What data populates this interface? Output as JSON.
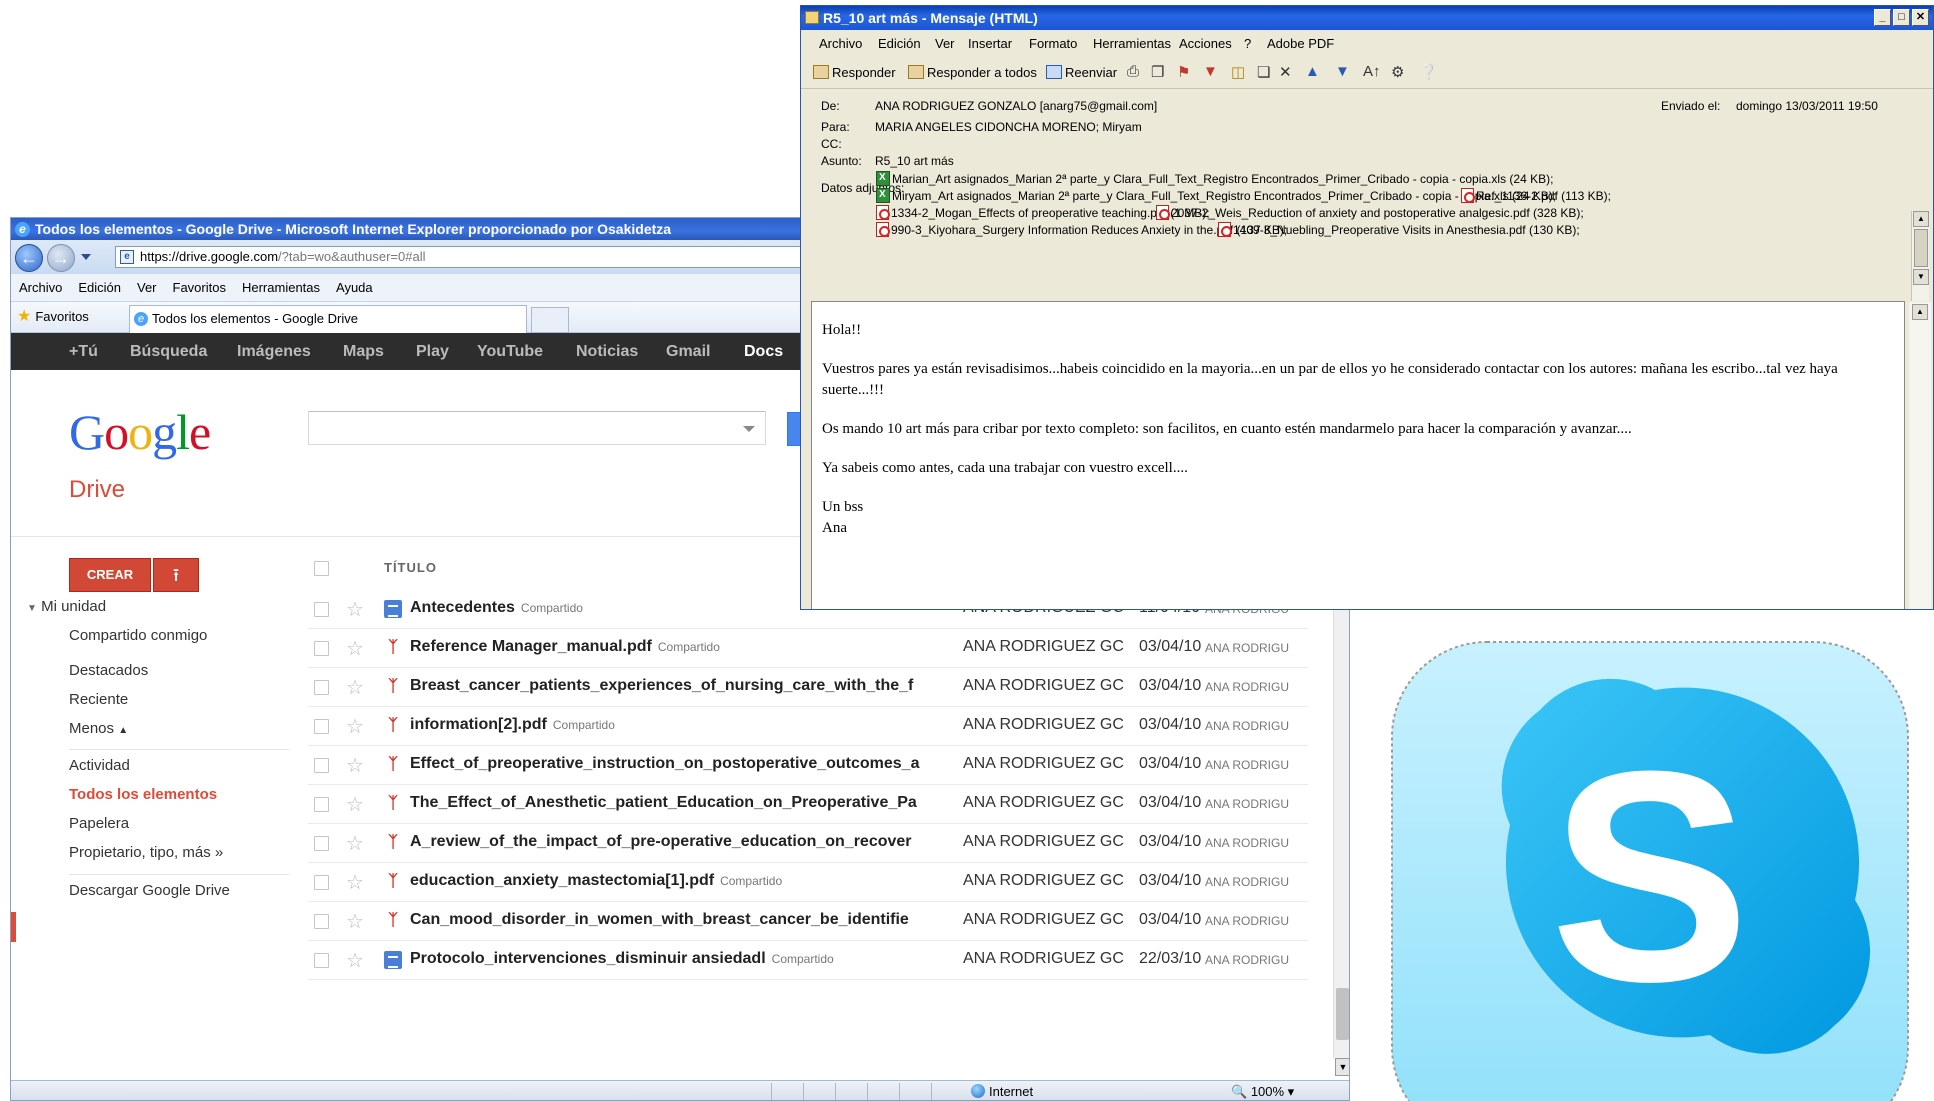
{
  "ie": {
    "title": "Todos los elementos - Google Drive - Microsoft Internet Explorer proporcionado por Osakidetza",
    "url_host": "https://drive.google.com",
    "url_rest": "/?tab=wo&authuser=0#all",
    "menu": [
      "Archivo",
      "Edición",
      "Ver",
      "Favoritos",
      "Herramientas",
      "Ayuda"
    ],
    "favorites_label": "Favoritos",
    "tab_label": "Todos los elementos - Google Drive",
    "status_zone": "Internet",
    "status_zoom": "100%"
  },
  "gbar": {
    "items": [
      "+Tú",
      "Búsqueda",
      "Imágenes",
      "Maps",
      "Play",
      "YouTube",
      "Noticias",
      "Gmail",
      "Docs"
    ],
    "active": "Docs"
  },
  "drive": {
    "logo": "Google",
    "title": "Drive",
    "create_label": "CREAR",
    "column_title": "TÍTULO",
    "sidebar": {
      "my_unit": "Mi unidad",
      "shared_with_me": "Compartido conmigo",
      "starred": "Destacados",
      "recent": "Reciente",
      "less": "Menos",
      "activity": "Actividad",
      "all_items": "Todos los elementos",
      "trash": "Papelera",
      "owner_type": "Propietario, tipo, más »",
      "download": "Descargar Google Drive"
    },
    "files": [
      {
        "icon": "doc-icon",
        "name": "Antecedentes",
        "shared": "Compartido",
        "owner": "ANA RODRIGUEZ GC",
        "date": "11/04/10",
        "modified_by": "ANA RODRIGU"
      },
      {
        "icon": "pdf-icon",
        "name": "Reference Manager_manual.pdf",
        "shared": "Compartido",
        "owner": "ANA RODRIGUEZ GC",
        "date": "03/04/10",
        "modified_by": "ANA RODRIGU"
      },
      {
        "icon": "pdf-icon",
        "name": "Breast_cancer_patients_experiences_of_nursing_care_with_the_f",
        "shared": "",
        "owner": "ANA RODRIGUEZ GC",
        "date": "03/04/10",
        "modified_by": "ANA RODRIGU"
      },
      {
        "icon": "pdf-icon",
        "name": "information[2].pdf",
        "shared": "Compartido",
        "owner": "ANA RODRIGUEZ GC",
        "date": "03/04/10",
        "modified_by": "ANA RODRIGU"
      },
      {
        "icon": "pdf-icon",
        "name": "Effect_of_preoperative_instruction_on_postoperative_outcomes_a",
        "shared": "",
        "owner": "ANA RODRIGUEZ GC",
        "date": "03/04/10",
        "modified_by": "ANA RODRIGU"
      },
      {
        "icon": "pdf-icon",
        "name": "The_Effect_of_Anesthetic_patient_Education_on_Preoperative_Pa",
        "shared": "",
        "owner": "ANA RODRIGUEZ GC",
        "date": "03/04/10",
        "modified_by": "ANA RODRIGU"
      },
      {
        "icon": "pdf-icon",
        "name": "A_review_of_the_impact_of_pre-operative_education_on_recover",
        "shared": "",
        "owner": "ANA RODRIGUEZ GC",
        "date": "03/04/10",
        "modified_by": "ANA RODRIGU"
      },
      {
        "icon": "pdf-icon",
        "name": "educaction_anxiety_mastectomia[1].pdf",
        "shared": "Compartido",
        "owner": "ANA RODRIGUEZ GC",
        "date": "03/04/10",
        "modified_by": "ANA RODRIGU"
      },
      {
        "icon": "pdf-icon",
        "name": "Can_mood_disorder_in_women_with_breast_cancer_be_identifie",
        "shared": "",
        "owner": "ANA RODRIGUEZ GC",
        "date": "03/04/10",
        "modified_by": "ANA RODRIGU"
      },
      {
        "icon": "doc-icon",
        "name": "Protocolo_intervenciones_disminuir ansiedadl",
        "shared": "Compartido",
        "owner": "ANA RODRIGUEZ GC",
        "date": "22/03/10",
        "modified_by": "ANA RODRIGU"
      }
    ]
  },
  "outlook": {
    "title": "R5_10 art más - Mensaje (HTML)",
    "menu": [
      "Archivo",
      "Edición",
      "Ver",
      "Insertar",
      "Formato",
      "Herramientas",
      "Acciones",
      "?",
      "Adobe PDF"
    ],
    "toolbar": {
      "reply": "Responder",
      "reply_all": "Responder a todos",
      "forward": "Reenviar"
    },
    "labels": {
      "from": "De:",
      "to": "Para:",
      "cc": "CC:",
      "subject": "Asunto:",
      "attachments": "Datos adjuntos:",
      "sent": "Enviado el:"
    },
    "from": "ANA RODRIGUEZ GONZALO [anarg75@gmail.com]",
    "to": "MARIA ANGELES CIDONCHA MORENO; Miryam",
    "cc": "",
    "subject": "R5_10 art más",
    "sent": "domingo 13/03/2011 19:50",
    "attachments": [
      {
        "type": "xls",
        "name": "Marian_Art asignados_Marian 2ª parte_y Clara_Full_Text_Registro Encontrados_Primer_Cribado - copia - copia.xls (24 KB);"
      },
      {
        "type": "xls",
        "name": "Miryam_Art asignados_Marian 2ª parte_y Clara_Full_Text_Registro Encontrados_Primer_Cribado - copia - copia.xls (24 KB);"
      },
      {
        "type": "pdf",
        "name": "Ref_1136-2.pdf (113 KB);"
      },
      {
        "type": "pdf",
        "name": "1334-2_Mogan_Effects of preoperative teaching.pdf (1 MB);"
      },
      {
        "type": "pdf",
        "name": "2037-2_Weis_Reduction of anxiety and postoperative analgesic.pdf (328 KB);"
      },
      {
        "type": "pdf",
        "name": "990-3_Kiyohara_Surgery Information Reduces Anxiety in the.pdf (137 KB);"
      },
      {
        "type": "pdf",
        "name": "1409-3_Nuebling_Preoperative Visits in Anesthesia.pdf (130 KB);"
      }
    ],
    "body": {
      "greeting": "Hola!!",
      "p1": "Vuestros pares ya están revisadisimos...habeis coincidido en la mayoria...en un par de ellos yo he considerado contactar con los autores: mañana les escribo...tal vez haya suerte...!!!",
      "p2": "Os mando 10 art más para cribar por texto completo: son facilitos, en cuanto estén mandarmelo para hacer la comparación y avanzar....",
      "p3": "Ya sabeis como antes, cada una trabajar con vuestro excell....",
      "sign1": "Un bss",
      "sign2": "Ana"
    }
  },
  "colors": {
    "drive_red": "#dd4b39",
    "create_red": "#d14836",
    "gbar": "#2d2d2d",
    "skype_blue": "#00aff0",
    "skype_light": "#aee8fb"
  }
}
